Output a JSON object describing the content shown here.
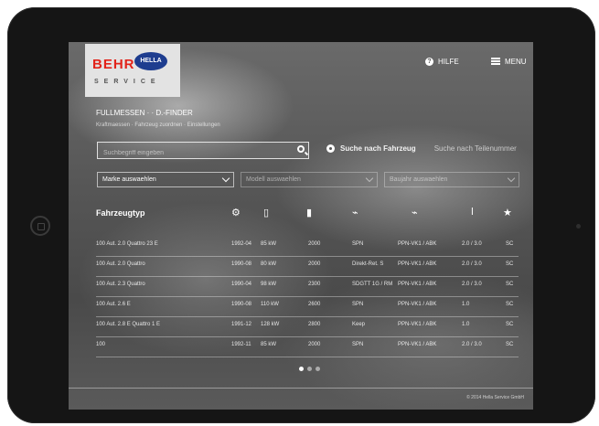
{
  "logo": {
    "behr": "BEHR",
    "hella": "HELLA",
    "service": "SERVICE"
  },
  "topnav": {
    "help_label": "HILFE",
    "help_icon_glyph": "?",
    "menu_label": "MENU"
  },
  "breadcrumb": {
    "main": "FULLMESSEN · · D.-FINDER",
    "sub": "Kraftmaessen  ·  Fahrzeug zuordnen  ·  Einstellungen"
  },
  "search": {
    "placeholder": "Suchbegriff eingeben",
    "radio_selected": "Suche nach Fahrzeug",
    "radio_other": "Suche nach Teilenummer"
  },
  "filters": [
    {
      "label": "Marke auswaehlen",
      "enabled": true
    },
    {
      "label": "Modell auswaehlen",
      "enabled": false
    },
    {
      "label": "Baujahr auswaehlen",
      "enabled": false
    }
  ],
  "table": {
    "header": {
      "vehicle": "Fahrzeugtyp",
      "fav_icon": "★"
    },
    "rows": [
      [
        "100 Aut. 2.0 Quattro 23 E",
        "1992-04",
        "85 kW",
        "2000",
        "SPN",
        "PPN-VK1 / ABK",
        "2.0 / 3.0",
        "SC"
      ],
      [
        "100 Aut. 2.0 Quattro",
        "1990-08",
        "80 kW",
        "2000",
        "Direkt-Ret. S",
        "PPN-VK1 / ABK",
        "2.0 / 3.0",
        "SC"
      ],
      [
        "100 Aut. 2.3 Quattro",
        "1990-04",
        "98 kW",
        "2300",
        "SDGTT 1G / RM",
        "PPN-VK1 / ABK",
        "2.0 / 3.0",
        "SC"
      ],
      [
        "100 Aut. 2.6 E",
        "1990-08",
        "110 kW",
        "2600",
        "SPN",
        "PPN-VK1 / ABK",
        "1.0",
        "SC"
      ],
      [
        "100 Aut. 2.8 E Quattro 1 E",
        "1991-12",
        "128 kW",
        "2800",
        "Keep",
        "PPN-VK1 / ABK",
        "1.0",
        "SC"
      ],
      [
        "100",
        "1992-11",
        "85 kW",
        "2000",
        "SPN",
        "PPN-VK1 / ABK",
        "2.0 / 3.0",
        "SC"
      ]
    ]
  },
  "pagination": {
    "pages": 3,
    "active": 1
  },
  "footer": {
    "copyright": "© 2014 Hella Service GmbH"
  }
}
